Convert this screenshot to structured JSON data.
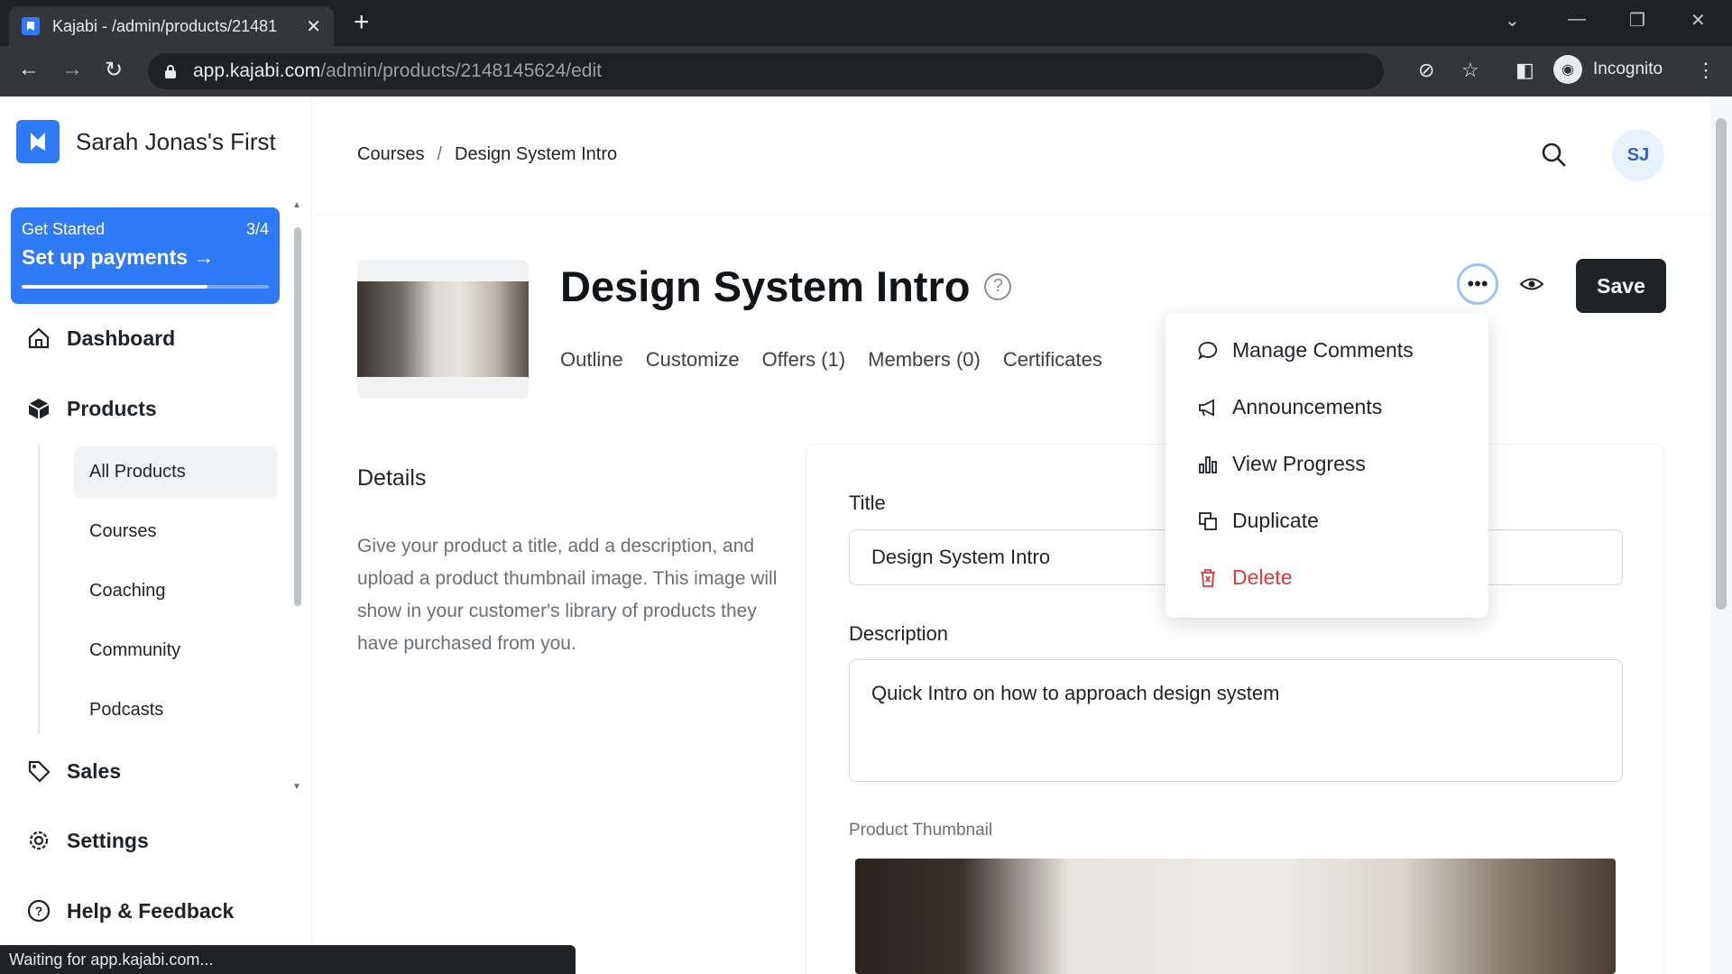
{
  "browser": {
    "tab_title": "Kajabi - /admin/products/21481",
    "url_host": "app.kajabi.com",
    "url_path": "/admin/products/2148145624/edit",
    "profile_label": "Incognito",
    "status_text": "Waiting for app.kajabi.com..."
  },
  "sidebar": {
    "site_name": "Sarah Jonas's First",
    "get_started": {
      "label": "Get Started",
      "count": "3/4",
      "cta": "Set up payments",
      "progress": 0.75
    },
    "items": [
      {
        "label": "Dashboard",
        "icon": "home-icon"
      },
      {
        "label": "Products",
        "icon": "cube-icon"
      },
      {
        "label": "Sales",
        "icon": "tag-icon"
      },
      {
        "label": "Settings",
        "icon": "gear-icon"
      },
      {
        "label": "Help & Feedback",
        "icon": "help-icon"
      }
    ],
    "products_sub": [
      "All Products",
      "Courses",
      "Coaching",
      "Community",
      "Podcasts"
    ]
  },
  "header": {
    "breadcrumb": [
      "Courses",
      "Design System Intro"
    ],
    "avatar_initials": "SJ"
  },
  "product": {
    "title": "Design System Intro",
    "tabs": [
      "Outline",
      "Customize",
      "Offers (1)",
      "Members (0)",
      "Certificates"
    ],
    "save_label": "Save"
  },
  "menu": {
    "items": [
      {
        "label": "Manage Comments",
        "icon": "comment-icon"
      },
      {
        "label": "Announcements",
        "icon": "megaphone-icon"
      },
      {
        "label": "View Progress",
        "icon": "bar-chart-icon"
      },
      {
        "label": "Duplicate",
        "icon": "duplicate-icon"
      },
      {
        "label": "Delete",
        "icon": "trash-icon"
      }
    ]
  },
  "details": {
    "heading": "Details",
    "description": "Give your product a title, add a description, and upload a product thumbnail image. This image will show in your customer's library of products they have purchased from you.",
    "title_label": "Title",
    "title_value": "Design System Intro",
    "description_label": "Description",
    "description_value": "Quick Intro on how to approach design system",
    "thumbnail_label": "Product Thumbnail"
  },
  "colors": {
    "accent": "#2f7af6",
    "danger": "#d93b3b",
    "save_bg": "#202326"
  }
}
